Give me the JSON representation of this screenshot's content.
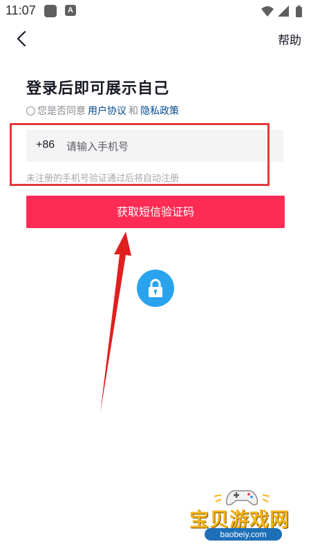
{
  "status_bar": {
    "time": "11:07",
    "notification_a": "A",
    "icons": [
      "app-notification-icon",
      "a-notification-icon",
      "wifi-icon",
      "cellular-signal-icon",
      "battery-icon"
    ]
  },
  "nav": {
    "back_icon": "back-arrow-icon",
    "help_label": "帮助"
  },
  "login": {
    "title": "登录后即可展示自己",
    "agree_prefix": "您是否同意",
    "user_agreement": "用户协议",
    "and": "和",
    "privacy_policy": "隐私政策",
    "country_code": "+86",
    "phone_placeholder": "请输入手机号",
    "phone_value": "",
    "hint": "未注册的手机号验证通过后将自动注册",
    "sms_button": "获取短信验证码",
    "lock_icon": "lock-icon"
  },
  "annotation": {
    "highlight_box_color": "#e23a3a",
    "arrow_color": "#e02020"
  },
  "watermark": {
    "text": "宝贝游戏网",
    "url": "baobeiy.com"
  },
  "colors": {
    "accent": "#fe2c55",
    "link": "#04498d",
    "lock_bg": "#2aa3ef"
  }
}
